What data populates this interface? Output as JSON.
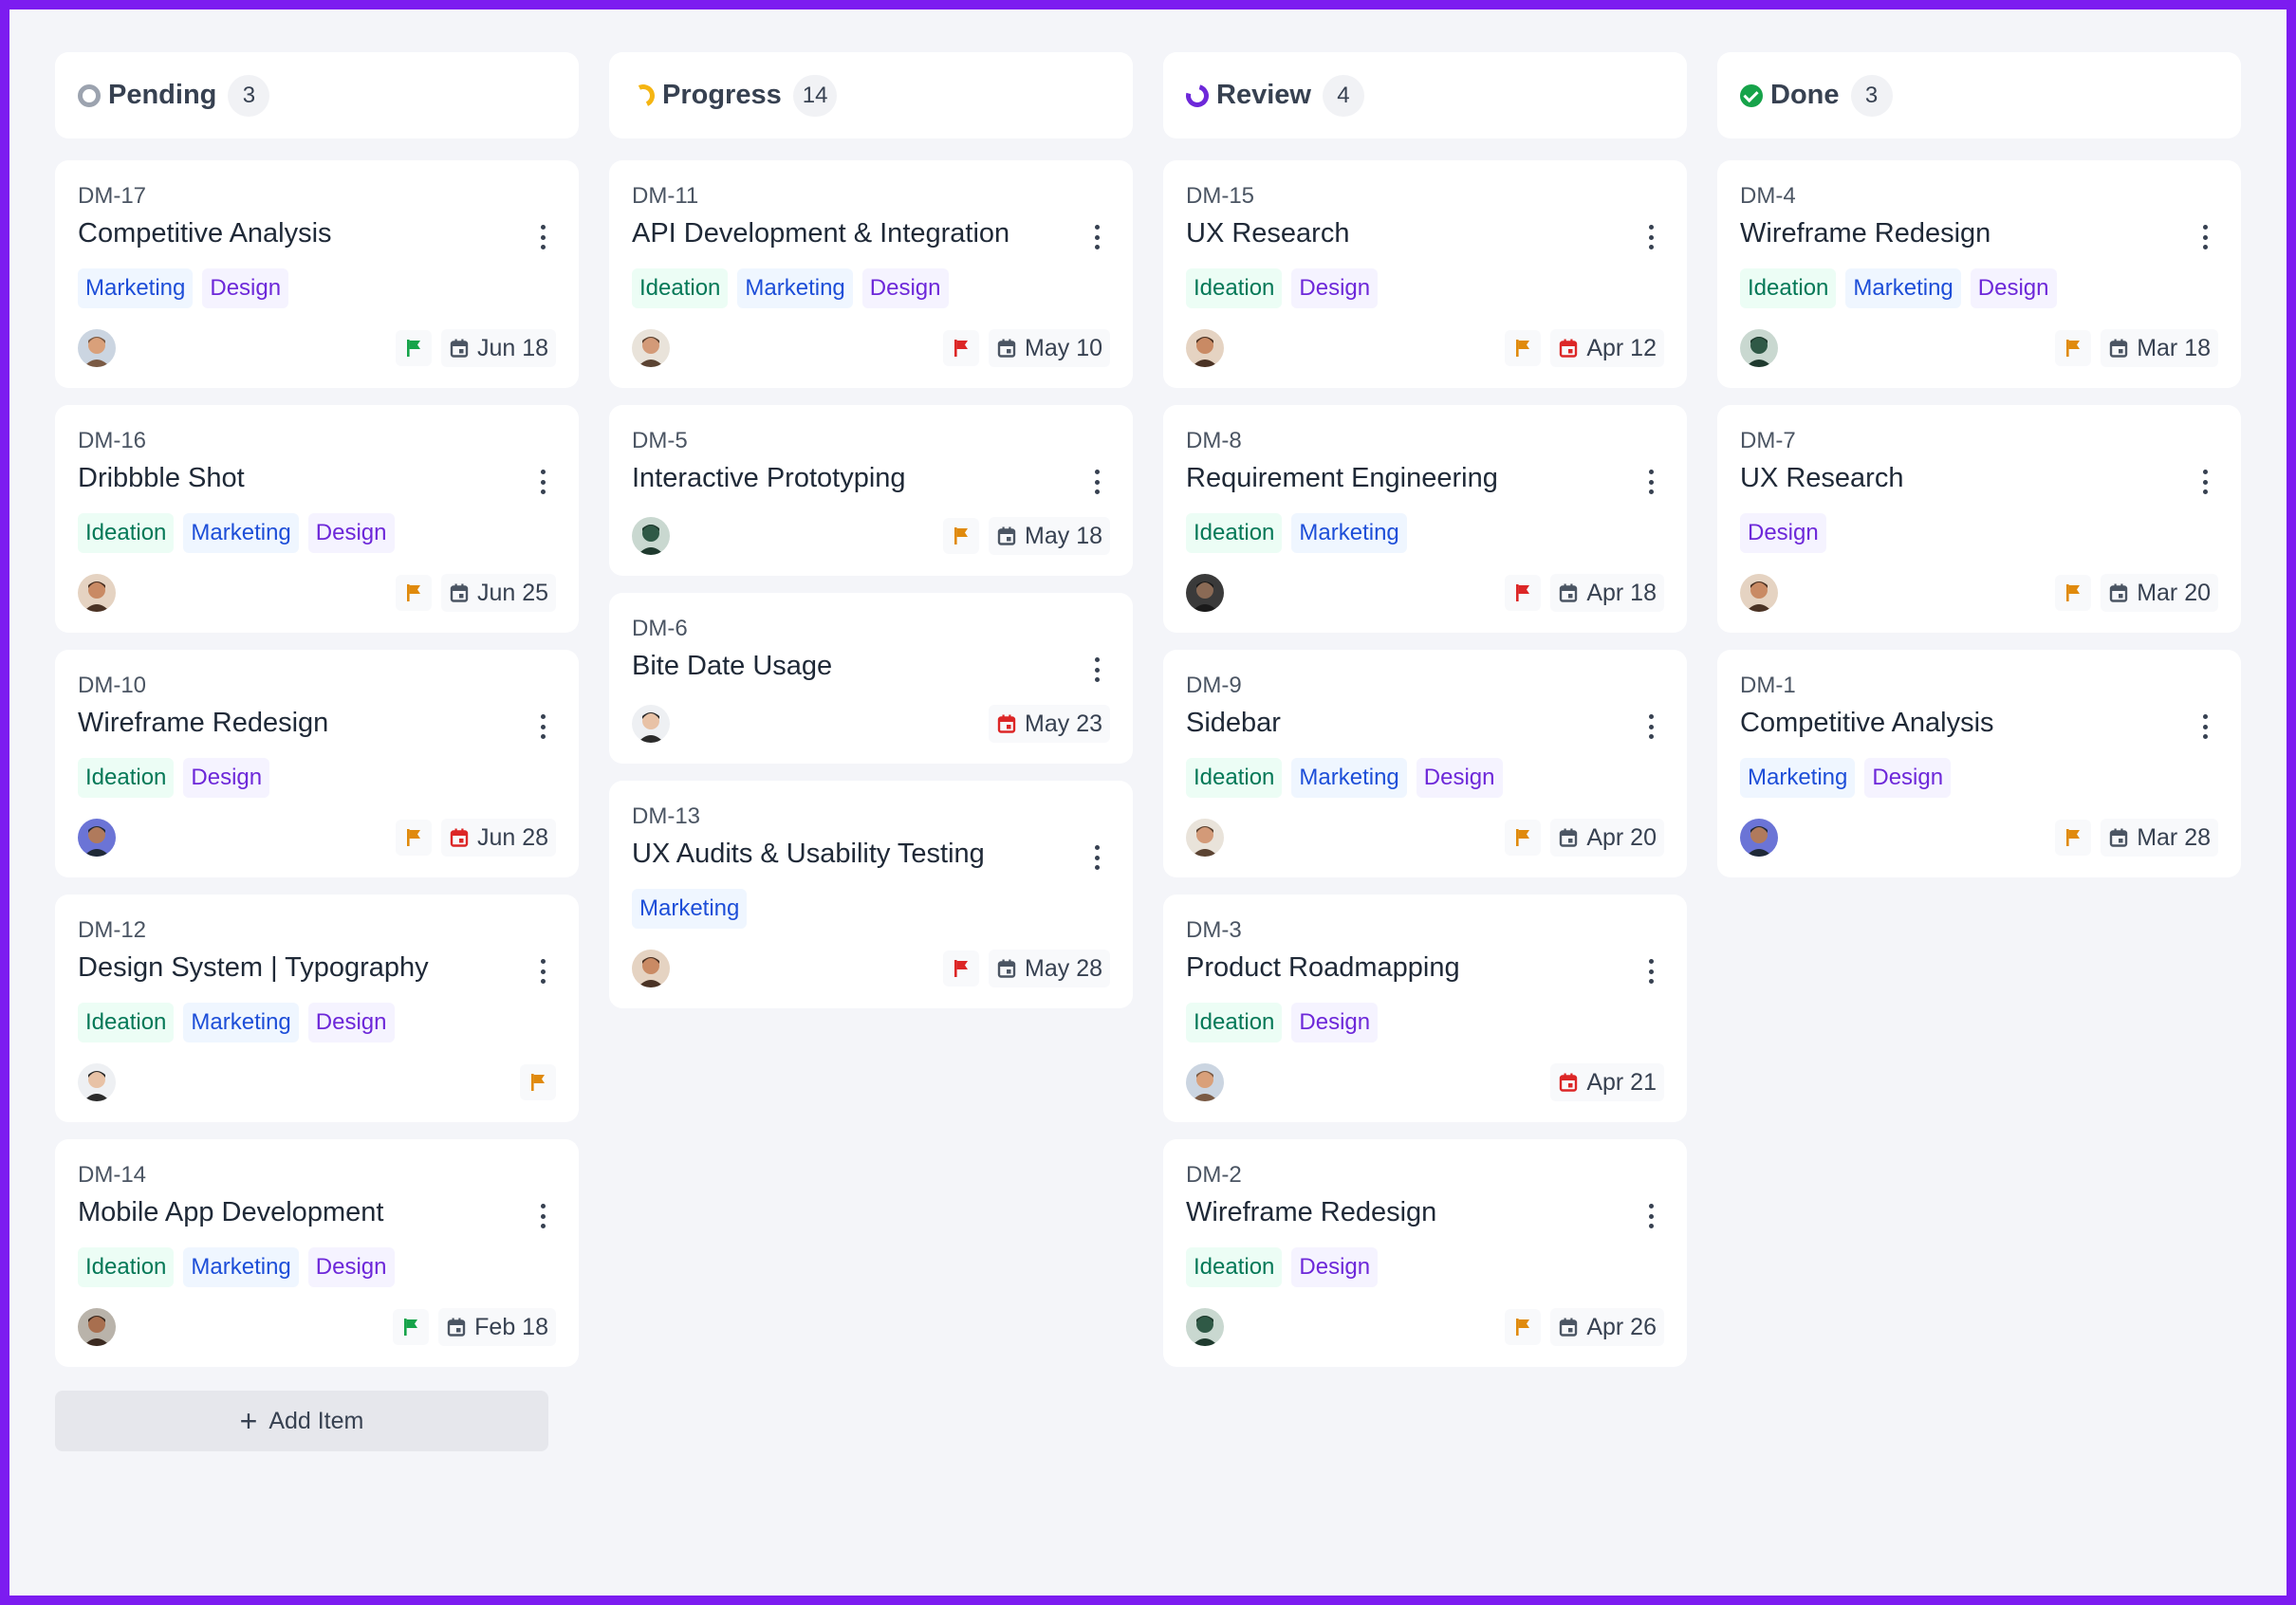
{
  "colors": {
    "frame": "#7c1cf0",
    "background": "#f4f5f9",
    "ideation": "#047857",
    "marketing": "#1d4ed8",
    "design": "#6d28d9",
    "flag_green": "#16a34a",
    "flag_orange": "#e08a0c",
    "flag_red": "#dc2626"
  },
  "board": {
    "add_item_label": "Add Item",
    "columns": [
      {
        "title": "Pending",
        "count": "3",
        "status_icon": "circle-outline-icon",
        "cards": [
          {
            "id": "DM-17",
            "title": "Competitive Analysis",
            "tags": [
              "Marketing",
              "Design"
            ],
            "avatar": 1,
            "flag": "green",
            "date": "Jun 18",
            "date_red": false
          },
          {
            "id": "DM-16",
            "title": "Dribbble Shot",
            "tags": [
              "Ideation",
              "Marketing",
              "Design"
            ],
            "avatar": 2,
            "flag": "orange",
            "date": "Jun 25",
            "date_red": false
          },
          {
            "id": "DM-10",
            "title": "Wireframe Redesign",
            "tags": [
              "Ideation",
              "Design"
            ],
            "avatar": 3,
            "flag": "orange",
            "date": "Jun 28",
            "date_red": true
          },
          {
            "id": "DM-12",
            "title": "Design System | Typography",
            "tags": [
              "Ideation",
              "Marketing",
              "Design"
            ],
            "avatar": 4,
            "flag": "orange",
            "date": "",
            "date_red": false
          },
          {
            "id": "DM-14",
            "title": "Mobile App Development",
            "tags": [
              "Ideation",
              "Marketing",
              "Design"
            ],
            "avatar": 5,
            "flag": "green",
            "date": "Feb 18",
            "date_red": false
          }
        ]
      },
      {
        "title": "Progress",
        "count": "14",
        "status_icon": "partial-circle-icon",
        "cards": [
          {
            "id": "DM-11",
            "title": "API Development & Integration",
            "tags": [
              "Ideation",
              "Marketing",
              "Design"
            ],
            "avatar": 6,
            "flag": "red",
            "date": "May 10",
            "date_red": false
          },
          {
            "id": "DM-5",
            "title": "Interactive Prototyping",
            "tags": [],
            "avatar": 7,
            "flag": "orange",
            "date": "May 18",
            "date_red": false
          },
          {
            "id": "DM-6",
            "title": "Bite Date Usage",
            "tags": [],
            "avatar": 4,
            "flag": "",
            "date": "May 23",
            "date_red": true
          },
          {
            "id": "DM-13",
            "title": "UX Audits & Usability Testing",
            "tags": [
              "Marketing"
            ],
            "avatar": 2,
            "flag": "red",
            "date": "May 28",
            "date_red": false
          }
        ]
      },
      {
        "title": "Review",
        "count": "4",
        "status_icon": "spinner-icon",
        "cards": [
          {
            "id": "DM-15",
            "title": "UX Research",
            "tags": [
              "Ideation",
              "Design"
            ],
            "avatar": 2,
            "flag": "orange",
            "date": "Apr 12",
            "date_red": true
          },
          {
            "id": "DM-8",
            "title": "Requirement Engineering",
            "tags": [
              "Ideation",
              "Marketing"
            ],
            "avatar": 8,
            "flag": "red",
            "date": "Apr 18",
            "date_red": false
          },
          {
            "id": "DM-9",
            "title": "Sidebar",
            "tags": [
              "Ideation",
              "Marketing",
              "Design"
            ],
            "avatar": 6,
            "flag": "orange",
            "date": "Apr 20",
            "date_red": false
          },
          {
            "id": "DM-3",
            "title": "Product Roadmapping",
            "tags": [
              "Ideation",
              "Design"
            ],
            "avatar": 1,
            "flag": "",
            "date": "Apr 21",
            "date_red": true
          },
          {
            "id": "DM-2",
            "title": "Wireframe Redesign",
            "tags": [
              "Ideation",
              "Design"
            ],
            "avatar": 7,
            "flag": "orange",
            "date": "Apr 26",
            "date_red": false
          }
        ]
      },
      {
        "title": "Done",
        "count": "3",
        "status_icon": "check-circle-icon",
        "cards": [
          {
            "id": "DM-4",
            "title": "Wireframe Redesign",
            "tags": [
              "Ideation",
              "Marketing",
              "Design"
            ],
            "avatar": 7,
            "flag": "orange",
            "date": "Mar 18",
            "date_red": false
          },
          {
            "id": "DM-7",
            "title": "UX Research",
            "tags": [
              "Design"
            ],
            "avatar": 2,
            "flag": "orange",
            "date": "Mar 20",
            "date_red": false
          },
          {
            "id": "DM-1",
            "title": "Competitive Analysis",
            "tags": [
              "Marketing",
              "Design"
            ],
            "avatar": 3,
            "flag": "orange",
            "date": "Mar 28",
            "date_red": false
          }
        ]
      }
    ]
  }
}
